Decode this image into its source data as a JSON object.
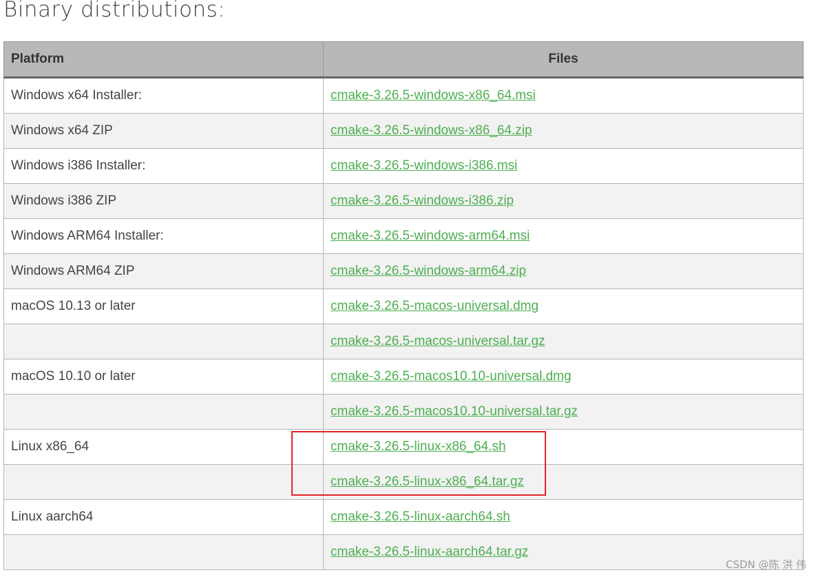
{
  "heading": "Binary distributions:",
  "table": {
    "headers": {
      "platform": "Platform",
      "files": "Files"
    },
    "rows": [
      {
        "platform": "Windows x64 Installer:",
        "file": "cmake-3.26.5-windows-x86_64.msi"
      },
      {
        "platform": "Windows x64 ZIP",
        "file": "cmake-3.26.5-windows-x86_64.zip"
      },
      {
        "platform": "Windows i386 Installer:",
        "file": "cmake-3.26.5-windows-i386.msi"
      },
      {
        "platform": "Windows i386 ZIP",
        "file": "cmake-3.26.5-windows-i386.zip"
      },
      {
        "platform": "Windows ARM64 Installer:",
        "file": "cmake-3.26.5-windows-arm64.msi"
      },
      {
        "platform": "Windows ARM64 ZIP",
        "file": "cmake-3.26.5-windows-arm64.zip"
      },
      {
        "platform": "macOS 10.13 or later",
        "file": "cmake-3.26.5-macos-universal.dmg"
      },
      {
        "platform": "",
        "file": "cmake-3.26.5-macos-universal.tar.gz"
      },
      {
        "platform": "macOS 10.10 or later",
        "file": "cmake-3.26.5-macos10.10-universal.dmg"
      },
      {
        "platform": "",
        "file": "cmake-3.26.5-macos10.10-universal.tar.gz"
      },
      {
        "platform": "Linux x86_64",
        "file": "cmake-3.26.5-linux-x86_64.sh"
      },
      {
        "platform": "",
        "file": "cmake-3.26.5-linux-x86_64.tar.gz"
      },
      {
        "platform": "Linux aarch64",
        "file": "cmake-3.26.5-linux-aarch64.sh"
      },
      {
        "platform": "",
        "file": "cmake-3.26.5-linux-aarch64.tar.gz"
      }
    ]
  },
  "watermark": "CSDN @陈 洪 伟",
  "colors": {
    "link": "#4caf50",
    "header_bg": "#b8b8b8",
    "row_alt_bg": "#f2f2f2",
    "highlight_border": "#e32228"
  }
}
